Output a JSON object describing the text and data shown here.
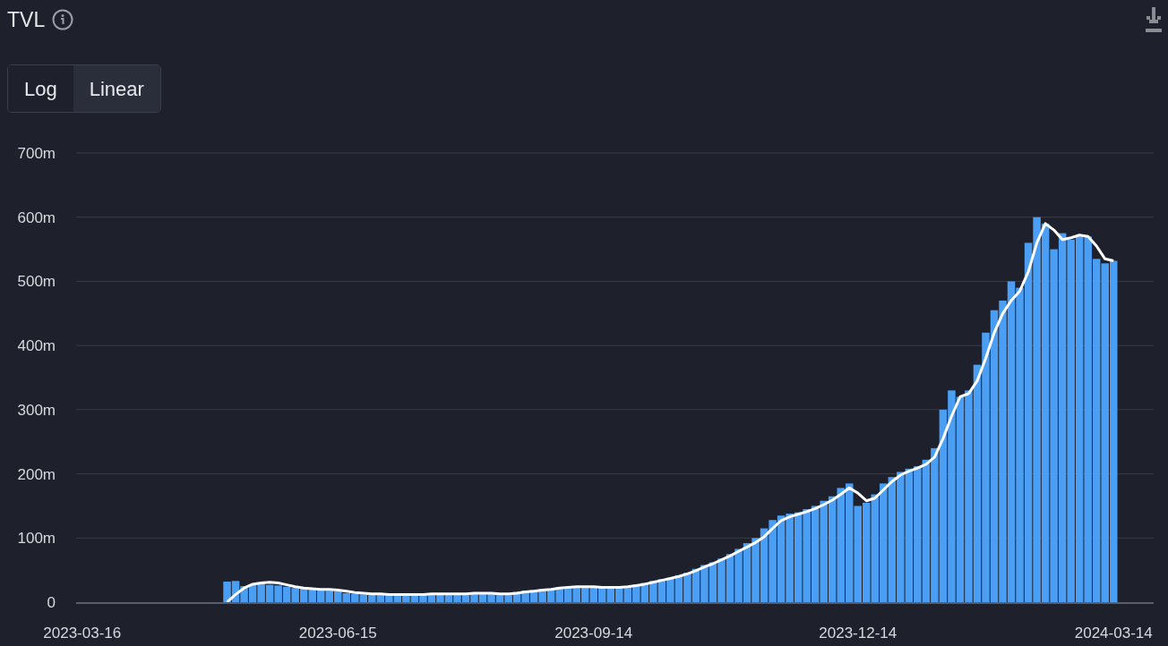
{
  "header": {
    "title": "TVL"
  },
  "scale_toggle": [
    {
      "label": "Log",
      "selected": false
    },
    {
      "label": "Linear",
      "selected": true
    }
  ],
  "chart": {
    "chart_data": {
      "type": "bar",
      "grid": true,
      "ylim": [
        0,
        700
      ],
      "yticks": [
        {
          "value": 0,
          "label": "0"
        },
        {
          "value": 100,
          "label": "100m"
        },
        {
          "value": 200,
          "label": "200m"
        },
        {
          "value": 300,
          "label": "300m"
        },
        {
          "value": 400,
          "label": "400m"
        },
        {
          "value": 500,
          "label": "500m"
        },
        {
          "value": 600,
          "label": "600m"
        },
        {
          "value": 700,
          "label": "700m"
        }
      ],
      "categories": [
        "2023-03-16",
        null,
        null,
        null,
        null,
        null,
        null,
        null,
        null,
        null,
        null,
        null,
        null,
        null,
        null,
        null,
        null,
        null,
        null,
        null,
        null,
        null,
        null,
        null,
        null,
        null,
        null,
        null,
        null,
        null,
        "2023-06-15",
        null,
        null,
        null,
        null,
        null,
        null,
        null,
        null,
        null,
        null,
        null,
        null,
        null,
        null,
        null,
        null,
        null,
        null,
        null,
        null,
        null,
        null,
        null,
        null,
        null,
        null,
        null,
        null,
        null,
        "2023-09-14",
        null,
        null,
        null,
        null,
        null,
        null,
        null,
        null,
        null,
        null,
        null,
        null,
        null,
        null,
        null,
        null,
        null,
        null,
        null,
        null,
        null,
        null,
        null,
        null,
        null,
        null,
        null,
        null,
        null,
        null,
        "2023-12-14",
        null,
        null,
        null,
        null,
        null,
        null,
        null,
        null,
        null,
        null,
        null,
        null,
        null,
        null,
        null,
        null,
        null,
        null,
        null,
        null,
        null,
        null,
        null,
        null,
        null,
        null,
        null,
        null,
        null,
        "2024-03-14"
      ],
      "series": [
        {
          "color": "#4a9ff5",
          "type": "bar",
          "values": [
            null,
            null,
            null,
            null,
            null,
            null,
            null,
            null,
            null,
            null,
            null,
            null,
            null,
            null,
            null,
            null,
            null,
            32,
            33,
            25,
            28,
            30,
            27,
            26,
            24,
            22,
            21,
            20,
            19,
            18,
            17,
            14,
            13,
            12,
            12,
            12,
            12,
            12,
            12,
            13,
            13,
            13,
            13,
            13,
            13,
            14,
            14,
            14,
            13,
            13,
            14,
            16,
            18,
            19,
            20,
            21,
            23,
            24,
            24,
            24,
            23,
            23,
            23,
            24,
            25,
            27,
            30,
            33,
            36,
            38,
            42,
            46,
            52,
            58,
            62,
            68,
            75,
            83,
            92,
            100,
            115,
            128,
            135,
            138,
            140,
            145,
            150,
            158,
            165,
            178,
            185,
            150,
            155,
            168,
            185,
            195,
            203,
            208,
            212,
            222,
            240,
            300,
            330,
            320,
            330,
            370,
            420,
            455,
            470,
            500,
            490,
            560,
            600,
            590,
            550,
            575,
            565,
            570,
            570,
            535,
            528,
            532
          ]
        },
        {
          "color": "#ffffff",
          "type": "line",
          "values": [
            null,
            null,
            null,
            null,
            null,
            null,
            null,
            null,
            null,
            null,
            null,
            null,
            null,
            null,
            null,
            null,
            null,
            0,
            12,
            22,
            28,
            30,
            31,
            30,
            27,
            24,
            22,
            21,
            20,
            20,
            19,
            17,
            15,
            14,
            13,
            13,
            12,
            12,
            12,
            12,
            12,
            13,
            13,
            13,
            13,
            13,
            14,
            14,
            14,
            13,
            13,
            14,
            16,
            17,
            19,
            20,
            22,
            23,
            24,
            24,
            24,
            23,
            23,
            23,
            24,
            26,
            28,
            31,
            34,
            37,
            40,
            44,
            49,
            55,
            60,
            66,
            72,
            79,
            86,
            93,
            102,
            115,
            127,
            133,
            137,
            141,
            146,
            152,
            159,
            168,
            178,
            170,
            158,
            162,
            175,
            188,
            198,
            204,
            209,
            215,
            226,
            255,
            290,
            320,
            325,
            345,
            380,
            420,
            450,
            470,
            485,
            515,
            560,
            590,
            580,
            565,
            568,
            572,
            570,
            555,
            535,
            532
          ]
        }
      ]
    }
  }
}
